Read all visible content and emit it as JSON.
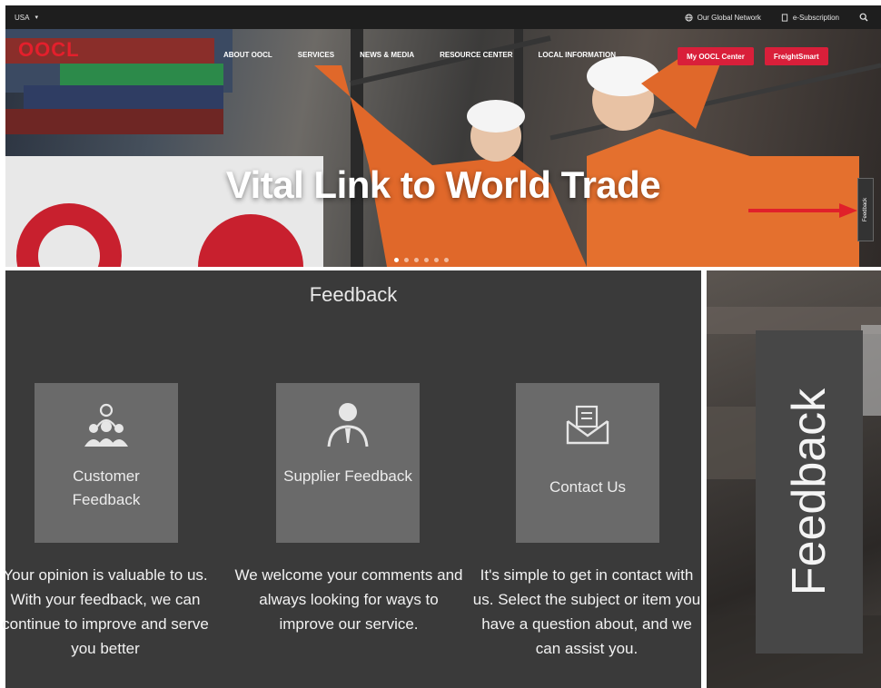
{
  "topbar": {
    "region": "USA",
    "global_network": "Our Global Network",
    "subscription": "e-Subscription"
  },
  "brand": {
    "logo_text": "OOCL",
    "brand_color": "#e41f2c"
  },
  "nav": {
    "items": [
      "ABOUT OOCL",
      "SERVICES",
      "NEWS & MEDIA",
      "RESOURCE CENTER",
      "LOCAL INFORMATION"
    ],
    "my_oocl": "My OOCL Center",
    "freightsmart": "FreightSmart",
    "button_color": "#d91f3a"
  },
  "hero": {
    "title": "Vital Link to World Trade",
    "slide_count": 6,
    "active_slide": 0,
    "side_tab": "Feedback"
  },
  "feedback": {
    "title": "Feedback",
    "cards": [
      {
        "label": "Customer Feedback",
        "icon": "customer-group-icon",
        "description": "Your opinion is valuable to us. With your feedback, we can continue to improve and serve you better"
      },
      {
        "label": "Supplier Feedback",
        "icon": "supplier-person-icon",
        "description": "We welcome your comments and always looking for ways to improve our service."
      },
      {
        "label": "Contact Us",
        "icon": "mail-envelope-icon",
        "description": "It's simple to get in contact with us. Select the subject or item you have a question about, and we can assist you."
      }
    ]
  },
  "side_panel": {
    "label": "Feedback"
  }
}
